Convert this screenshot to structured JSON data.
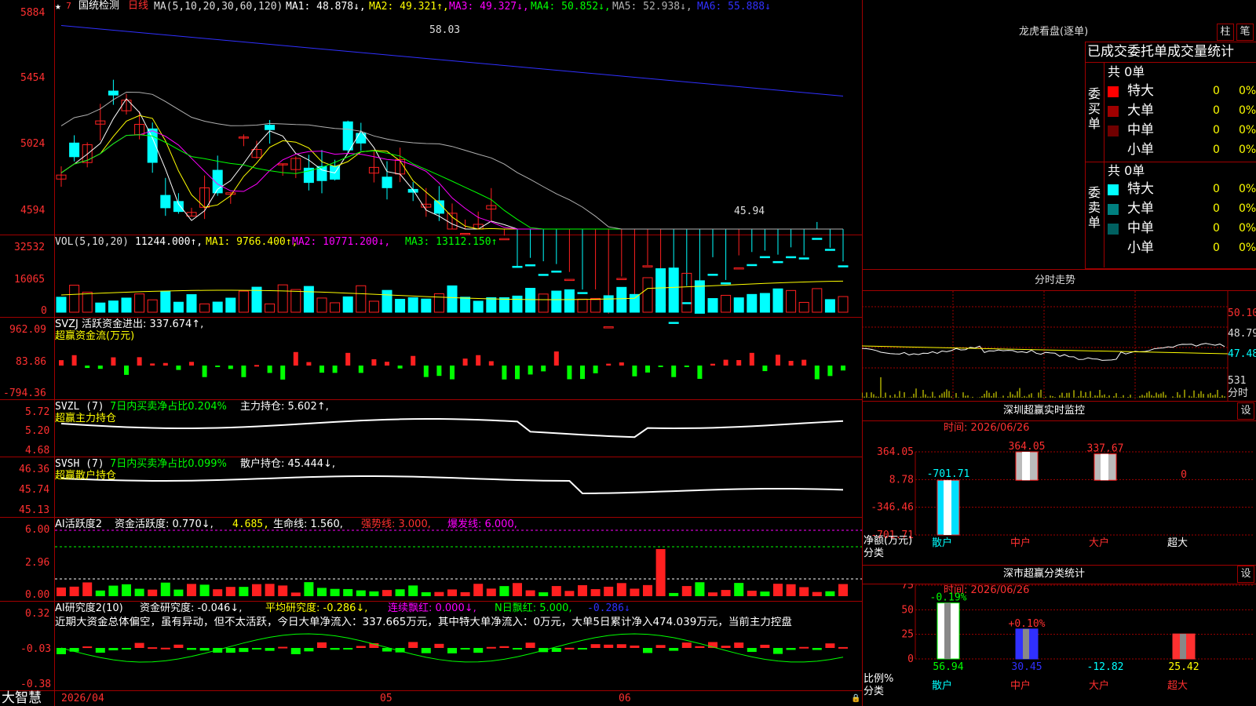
{
  "colors": {
    "up": "#ff2020",
    "down": "#00ffff",
    "yellow": "#ffff00",
    "magenta": "#ff00ff",
    "green": "#00ff00",
    "white": "#ffffff",
    "grid": "#a00000",
    "axis": "#ff3030",
    "blue": "#3030ff",
    "gray": "#b0b0b0"
  },
  "main": {
    "title_prefix": "★",
    "stock_name": "国统检测",
    "period": "日线",
    "ma_header": "MA(5,10,20,30,60,120)",
    "ma1": "MA1: 48.878↓,",
    "ma2": "MA2: 49.321↑,",
    "ma3": "MA3: 49.327↓,",
    "ma4": "MA4: 50.852↓,",
    "ma5": "MA5: 52.938↓,",
    "ma6": "MA6: 55.888↓",
    "y_ticks": [
      "5884",
      "5454",
      "5024",
      "4594"
    ],
    "high_label": "58.03",
    "low_label": "45.94"
  },
  "vol": {
    "header": "VOL(5,10,20)",
    "value": "11244.000↑,",
    "ma1": "MA1: 9766.400↑,",
    "ma2": "MA2: 10771.200↓,",
    "ma3": "MA3: 13112.150↑",
    "y_ticks": [
      "32532",
      "16065",
      "0"
    ]
  },
  "svzj": {
    "header": "SVZJ  活跃资金进出: 337.674↑,",
    "sub": "超赢资金流(万元)",
    "y_ticks": [
      "962.09",
      "83.86",
      "-794.36"
    ]
  },
  "svzl": {
    "header_a": "SVZL (7)",
    "header_b": "7日内买卖净占比0.204%",
    "header_c": "主力持仓: 5.602↑,",
    "sub": "超赢主力持仓",
    "y_ticks": [
      "5.72",
      "5.20",
      "4.68"
    ]
  },
  "svsh": {
    "header_a": "SVSH (7)",
    "header_b": "7日内买卖净占比0.099%",
    "header_c": "散户持仓: 45.444↓,",
    "sub": "超赢散户持仓",
    "y_ticks": [
      "46.36",
      "45.74",
      "45.13"
    ]
  },
  "ai1": {
    "header_a": "AI活跃度2",
    "header_b": "资金活跃度: 0.770↓,",
    "header_c": "4.685,",
    "header_d": "生命线: 1.560,",
    "header_e": "强势线: 3.000,",
    "header_f": "爆发线: 6.000,",
    "y_ticks": [
      "6.00",
      "2.96",
      "0.00"
    ]
  },
  "ai2": {
    "header_a": "AI研究度2(10)",
    "header_b": "资金研究度: -0.046↓,",
    "header_c": "平均研究度: -0.286↓,",
    "header_d": "连续飘红: 0.000↓,",
    "header_e": "N日飘红: 5.000,",
    "header_f": "-0.286↓",
    "comment": "近期大资金总体偏空，虽有异动，但不太活跃，今日大单净流入：337.665万元，其中特大单净流入：0万元，大单5日累计净入474.039万元，当前主力控盘",
    "y_ticks": [
      "0.32",
      "-0.03",
      "-0.38"
    ]
  },
  "bottom": {
    "brand": "大智慧",
    "dates": [
      "2026/04",
      "05",
      "06"
    ]
  },
  "dragon": {
    "title": "龙虎看盘(逐单)",
    "btn_zhu": "柱",
    "btn_bi": "笔",
    "table_title": "已成交委托单成交量统计",
    "buy_label": "委买单",
    "sell_label": "委卖单",
    "buy_total": "共 0单",
    "sell_total": "共 0单",
    "rows_buy": [
      {
        "name": "特大",
        "count": "0",
        "pct": "0%",
        "color": "#ff0000"
      },
      {
        "name": "大单",
        "count": "0",
        "pct": "0%",
        "color": "#a00000"
      },
      {
        "name": "中单",
        "count": "0",
        "pct": "0%",
        "color": "#700000"
      },
      {
        "name": "小单",
        "count": "0",
        "pct": "0%",
        "color": "#000000"
      }
    ],
    "rows_sell": [
      {
        "name": "特大",
        "count": "0",
        "pct": "0%",
        "color": "#00ffff"
      },
      {
        "name": "大单",
        "count": "0",
        "pct": "0%",
        "color": "#008080"
      },
      {
        "name": "中单",
        "count": "0",
        "pct": "0%",
        "color": "#006060"
      },
      {
        "name": "小单",
        "count": "0",
        "pct": "0%",
        "color": "#000000"
      }
    ]
  },
  "intraday": {
    "title": "分时走势",
    "y_ticks": [
      "50.10",
      "48.79",
      "47.48"
    ],
    "vol_label": "531",
    "footer": "分时"
  },
  "monitor": {
    "title": "深圳超赢实时监控",
    "btn": "设",
    "time": "时间: 2026/06/26",
    "y_ticks": [
      "364.05",
      "8.78",
      "-346.46",
      "-701.71"
    ],
    "axis_label_a": "净额(万元)",
    "axis_label_b": "分类",
    "bars": [
      {
        "name": "散户",
        "value": -701.71,
        "label": "-701.71"
      },
      {
        "name": "中户",
        "value": 364.05,
        "label": "364.05"
      },
      {
        "name": "大户",
        "value": 337.67,
        "label": "337.67"
      },
      {
        "name": "超大",
        "value": 0,
        "label": "0"
      }
    ]
  },
  "classify": {
    "title": "深市超赢分类统计",
    "btn": "设",
    "time": "时间: 2026/06/26",
    "y_ticks": [
      "75",
      "50",
      "25",
      "0"
    ],
    "axis_label_a": "比例%",
    "axis_label_b": "分类",
    "bars": [
      {
        "name": "散户",
        "top": "-0.19%",
        "bottom": "56.94",
        "value": 56.94,
        "color": "#ffffff"
      },
      {
        "name": "中户",
        "top": "+0.10%",
        "bottom": "30.45",
        "value": 30.45,
        "color": "#3030ff"
      },
      {
        "name": "大户",
        "top": "",
        "bottom": "-12.82",
        "value": 0,
        "color": "#00ffff"
      },
      {
        "name": "超大",
        "top": "",
        "bottom": "25.42",
        "value": 25.42,
        "color": "#ff3030"
      }
    ]
  }
}
